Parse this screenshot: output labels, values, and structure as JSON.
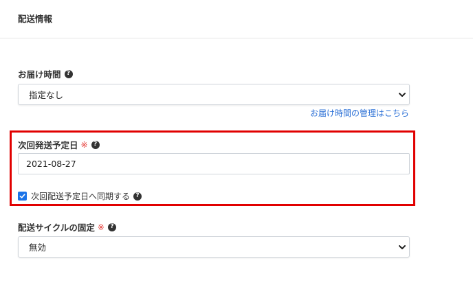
{
  "section": {
    "title": "配送情報"
  },
  "delivery_time": {
    "label": "お届け時間",
    "help_icon": "question-circle-icon",
    "selected": "指定なし",
    "manage_link": "お届け時間の管理はこちら"
  },
  "next_ship_date": {
    "label": "次回発送予定日",
    "required_mark": "※",
    "help_icon": "question-circle-icon",
    "value": "2021-08-27",
    "sync_checkbox": {
      "label": "次回配送予定日へ同期する",
      "checked": true
    }
  },
  "fixed_cycle": {
    "label": "配送サイクルの固定",
    "required_mark": "※",
    "help_icon": "question-circle-icon",
    "selected": "無効"
  },
  "colors": {
    "highlight": "#e10000",
    "link": "#2a6fd6",
    "required": "#e53935",
    "checkbox": "#1a73e8"
  }
}
